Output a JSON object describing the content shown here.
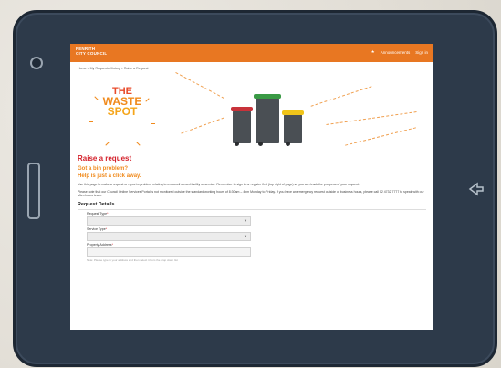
{
  "site": {
    "logo_line1": "PENRITH",
    "logo_line2": "CITY COUNCIL",
    "nav": [
      "Announcements",
      "Sign in"
    ]
  },
  "breadcrumbs": "Home  >  My Requests History  >  Raise a Request",
  "hero": {
    "line1": "THE",
    "line2": "WASTE",
    "line3": "SPOT"
  },
  "page": {
    "title": "Raise a request",
    "subtitle1": "Got a bin problem?",
    "subtitle2": "Help is just a click away.",
    "intro": "Use this page to make a request or report a problem relating to a council owned facility or service. Remember to sign in or register first (top right of page) so you can track the progress of your request.",
    "notice": "Please note that our Council Online Services Portal is not monitored outside the standard working hours of 8:30am – 4pm Monday to Friday. If you have an emergency request outside of business hours, please call 02 4732 7777 to speak with our after-hours team.",
    "section": "Request Details"
  },
  "form": {
    "request_type_label": "Request Type",
    "service_type_label": "Service Type",
    "property_label": "Property Address",
    "required_mark": "*",
    "hint": "Note: Please type in your address and then select it from the drop down list"
  },
  "colors": {
    "brand": "#e87722",
    "title": "#d4202a",
    "accent": "#f08a1c"
  }
}
